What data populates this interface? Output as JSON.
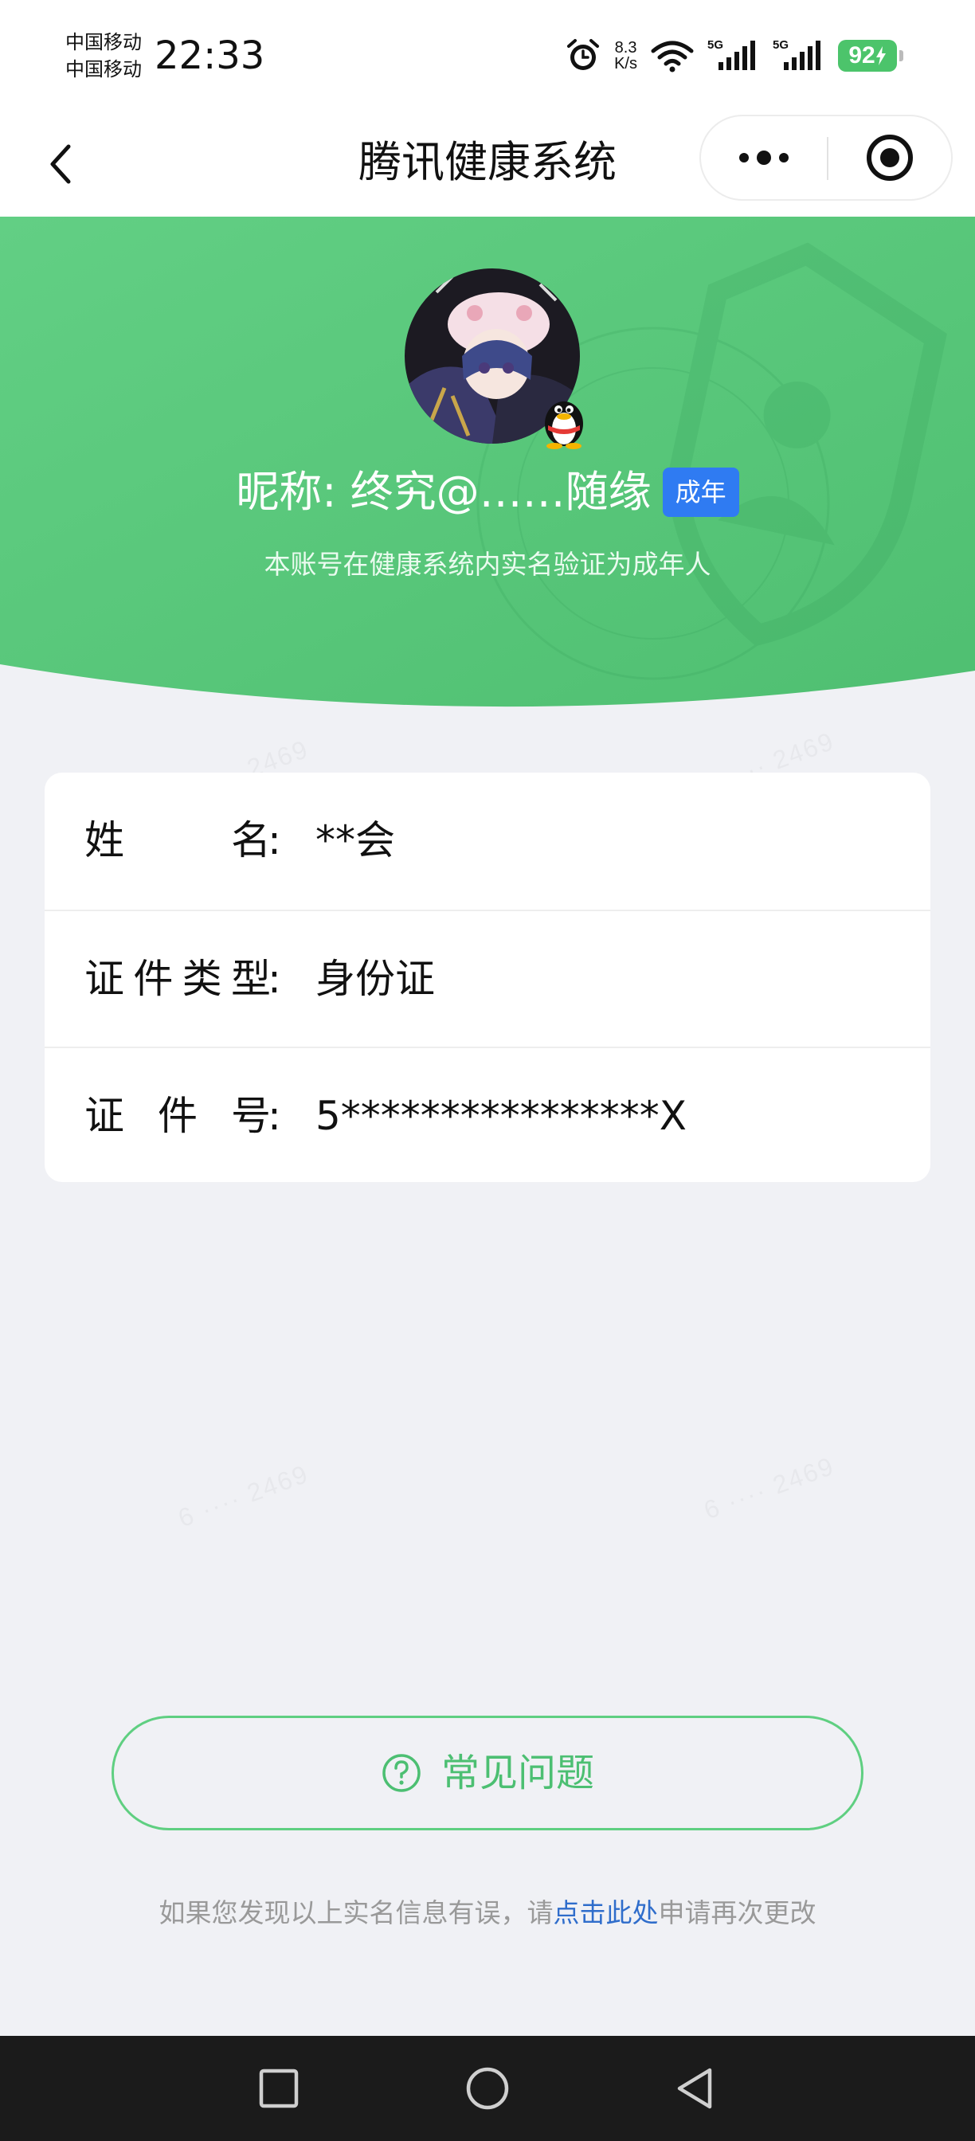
{
  "status_bar": {
    "carrier_1": "中国移动",
    "carrier_2": "中国移动",
    "time": "22:33",
    "net_speed_value": "8.3",
    "net_speed_unit": "K/s",
    "signal_1_label": "5G",
    "signal_2_label": "5G",
    "battery_level": "92"
  },
  "nav": {
    "title": "腾讯健康系统"
  },
  "profile": {
    "nickname": "昵称: 终究@……随缘",
    "badge": "成年",
    "description": "本账号在健康系统内实名验证为成年人"
  },
  "info": {
    "rows": [
      {
        "label": "姓名",
        "value": "**会"
      },
      {
        "label": "证件类型",
        "value": "身份证"
      },
      {
        "label": "证件号",
        "value": "5****************X"
      }
    ],
    "colon": ":"
  },
  "faq": {
    "label": "常见问题"
  },
  "footer": {
    "text_before": "如果您发现以上实名信息有误，请",
    "link_text": "点击此处",
    "text_after": "申请再次更改"
  },
  "colors": {
    "brand_green": "#5fcf81",
    "badge_blue": "#2f7bf2",
    "link_blue": "#2f6dcb",
    "battery_green": "#4cc46b"
  },
  "icons": {
    "back": "chevron-left-icon",
    "more": "more-dots-icon",
    "close": "target-circle-icon",
    "faq": "question-circle-icon",
    "alarm": "alarm-clock-icon",
    "wifi": "wifi-icon",
    "signal": "signal-bars-icon",
    "qq": "qq-penguin-icon"
  }
}
